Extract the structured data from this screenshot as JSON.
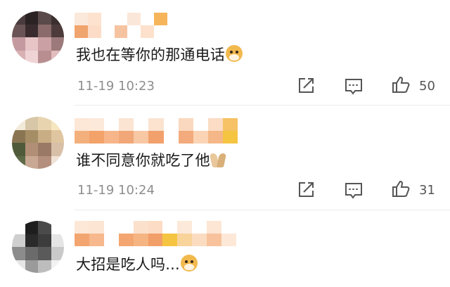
{
  "comments": [
    {
      "text": "我也在等你的那通电话",
      "emoji": "doge-emoji",
      "time": "11-19 10:23",
      "likes": "50"
    },
    {
      "text": "谁不同意你就吃了他",
      "emoji": "pray-emoji",
      "time": "11-19 10:24",
      "likes": "31"
    },
    {
      "text": "大招是吃人吗...",
      "emoji": "doge-emoji",
      "time": "",
      "likes": ""
    }
  ],
  "colors": {
    "timestamp": "#8e8e8e",
    "text": "#1a1a1a",
    "icon": "#555555",
    "divider": "#ececec",
    "name_mosaic_orange": "#f0a56e",
    "name_mosaic_yellow": "#f5c542"
  },
  "icons": [
    "share-icon",
    "comment-icon",
    "like-icon",
    "doge-emoji",
    "pray-emoji"
  ]
}
